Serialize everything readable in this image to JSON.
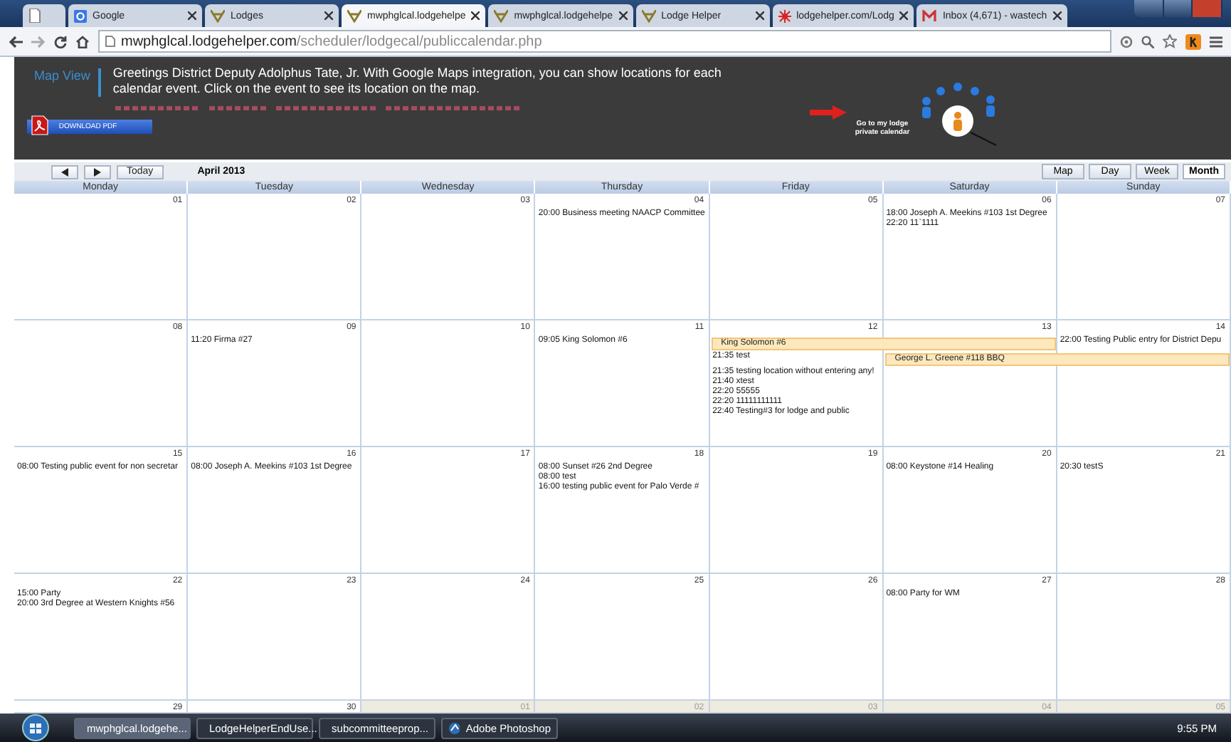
{
  "browser": {
    "tabs": [
      {
        "selected": false
      },
      {
        "title": "Google",
        "selected": false
      },
      {
        "title": "Lodges",
        "selected": false
      },
      {
        "title": "mwphglcal.lodgehelpe",
        "selected": true
      },
      {
        "title": "mwphglcal.lodgehelpe",
        "selected": false
      },
      {
        "title": "Lodge Helper",
        "selected": false
      },
      {
        "title": "lodgehelper.com/Lodg",
        "selected": false
      },
      {
        "title": "Inbox (4,671) - wastech",
        "selected": false
      }
    ],
    "address": {
      "host": "mwphglcal.lodgehelper.com",
      "path": "/scheduler/lodgecal/publiccalendar.php"
    }
  },
  "header": {
    "map_link": "Map View",
    "greeting": "Greetings District Deputy Adolphus Tate, Jr. With Google Maps integration, you can show locations for each calendar event. Click on the event to see its location on the map.",
    "download_button": "DOWNLOAD PDF",
    "private_link": "Go to my lodge private calendar"
  },
  "toolbar": {
    "today": "Today",
    "period": "April 2013",
    "views": [
      {
        "label": "Map",
        "selected": false
      },
      {
        "label": "Day",
        "selected": false
      },
      {
        "label": "Week",
        "selected": false
      },
      {
        "label": "Month",
        "selected": true
      }
    ]
  },
  "calendar": {
    "weekdays": [
      "Monday",
      "Tuesday",
      "Wednesday",
      "Thursday",
      "Friday",
      "Saturday",
      "Sunday"
    ],
    "weeks": [
      {
        "days": [
          {
            "number": "01",
            "other_month": false
          },
          {
            "number": "02",
            "other_month": false
          },
          {
            "number": "03",
            "other_month": false
          },
          {
            "number": "04",
            "other_month": false,
            "events": [
              {
                "kind": "item",
                "text": "20:00 Business meeting NAACP Committee"
              }
            ]
          },
          {
            "number": "05",
            "other_month": false
          },
          {
            "number": "06",
            "other_month": false,
            "events": [
              {
                "kind": "item",
                "text": "18:00 Joseph A. Meekins #103 1st Degree"
              },
              {
                "kind": "item",
                "text": "22:20 11`1111"
              }
            ]
          },
          {
            "number": "07",
            "other_month": false
          }
        ]
      },
      {
        "days": [
          {
            "number": "08",
            "other_month": false
          },
          {
            "number": "09",
            "other_month": false,
            "events": [
              {
                "kind": "item",
                "text": "11:20 Firma #27"
              }
            ]
          },
          {
            "number": "10",
            "other_month": false
          },
          {
            "number": "11",
            "other_month": false,
            "events": [
              {
                "kind": "item",
                "text": "09:05 King Solomon #6"
              }
            ]
          },
          {
            "number": "12",
            "other_month": false,
            "events": [
              {
                "kind": "bar",
                "text": "King Solomon #6"
              },
              {
                "kind": "item",
                "text": "21:35 test"
              },
              {
                "kind": "item",
                "text": "21:35 testing location without entering any!"
              },
              {
                "kind": "item",
                "text": "21:40 xtest"
              },
              {
                "kind": "item",
                "text": "22:20 55555"
              },
              {
                "kind": "item",
                "text": "22:20 11111111111"
              },
              {
                "kind": "item",
                "text": "22:40 Testing#3 for lodge and public"
              }
            ]
          },
          {
            "number": "13",
            "other_month": false,
            "events": [
              {
                "kind": "bar-continued"
              },
              {
                "kind": "bar",
                "text": "George L. Greene #118 BBQ"
              }
            ]
          },
          {
            "number": "14",
            "other_month": false,
            "events": [
              {
                "kind": "item",
                "text": "22:00 Testing Public entry for District Depu"
              },
              {
                "kind": "bar-continued"
              }
            ]
          }
        ]
      },
      {
        "days": [
          {
            "number": "15",
            "other_month": false,
            "events": [
              {
                "kind": "item",
                "text": "08:00 Testing public event for non secretar"
              }
            ]
          },
          {
            "number": "16",
            "other_month": false,
            "events": [
              {
                "kind": "item",
                "text": "08:00 Joseph A. Meekins #103 1st Degree"
              }
            ]
          },
          {
            "number": "17",
            "other_month": false
          },
          {
            "number": "18",
            "other_month": false,
            "events": [
              {
                "kind": "item",
                "text": "08:00 Sunset #26 2nd Degree"
              },
              {
                "kind": "item",
                "text": "08:00 test"
              },
              {
                "kind": "item",
                "text": "16:00 testing public event for Palo Verde #"
              }
            ]
          },
          {
            "number": "19",
            "other_month": false
          },
          {
            "number": "20",
            "other_month": false,
            "events": [
              {
                "kind": "item",
                "text": "08:00 Keystone #14 Healing"
              }
            ]
          },
          {
            "number": "21",
            "other_month": false,
            "events": [
              {
                "kind": "item",
                "text": "20:30 testS"
              }
            ]
          }
        ]
      },
      {
        "days": [
          {
            "number": "22",
            "other_month": false,
            "events": [
              {
                "kind": "item",
                "text": "15:00 Party"
              },
              {
                "kind": "item",
                "text": "20:00 3rd Degree at Western Knights #56"
              }
            ]
          },
          {
            "number": "23",
            "other_month": false
          },
          {
            "number": "24",
            "other_month": false
          },
          {
            "number": "25",
            "other_month": false
          },
          {
            "number": "26",
            "other_month": false
          },
          {
            "number": "27",
            "other_month": false,
            "events": [
              {
                "kind": "item",
                "text": "08:00 Party for WM"
              }
            ]
          },
          {
            "number": "28",
            "other_month": false
          }
        ]
      },
      {
        "days": [
          {
            "number": "29",
            "other_month": false
          },
          {
            "number": "30",
            "other_month": false
          },
          {
            "number": "01",
            "other_month": true
          },
          {
            "number": "02",
            "other_month": true
          },
          {
            "number": "03",
            "other_month": true
          },
          {
            "number": "04",
            "other_month": true
          },
          {
            "number": "05",
            "other_month": true
          }
        ]
      }
    ]
  },
  "taskbar": {
    "items": [
      {
        "label": "mwphglcal.lodgehe...",
        "selected": true
      },
      {
        "label": "LodgeHelperEndUse...",
        "selected": false
      },
      {
        "label": "subcommitteeprop...",
        "selected": false
      },
      {
        "label": "Adobe Photoshop",
        "selected": false
      }
    ],
    "clock": "9:55 PM"
  }
}
